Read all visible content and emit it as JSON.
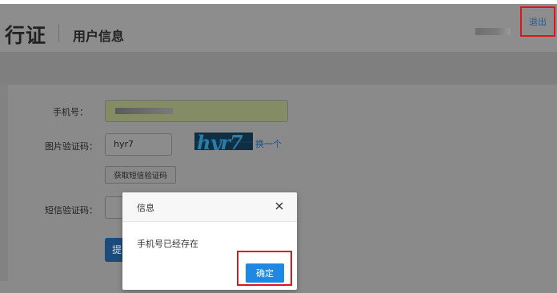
{
  "header": {
    "brand_fragment": "行证",
    "page_title": "用户信息",
    "logout_label": "退出"
  },
  "form": {
    "phone_label": "手机号：",
    "captcha_label": "图片验证码：",
    "captcha_value": "hyr7",
    "captcha_image_text": "hyr7",
    "refresh_captcha_label": "换一个",
    "get_sms_code_label": "获取短信验证码",
    "sms_code_label": "短信验证码：",
    "submit_label_fragment": "提"
  },
  "modal": {
    "title": "信息",
    "message": "手机号已经存在",
    "confirm_label": "确定"
  },
  "colors": {
    "highlight": "#e0141b",
    "primary_button": "#1e88e5",
    "link": "#1f5b96"
  }
}
